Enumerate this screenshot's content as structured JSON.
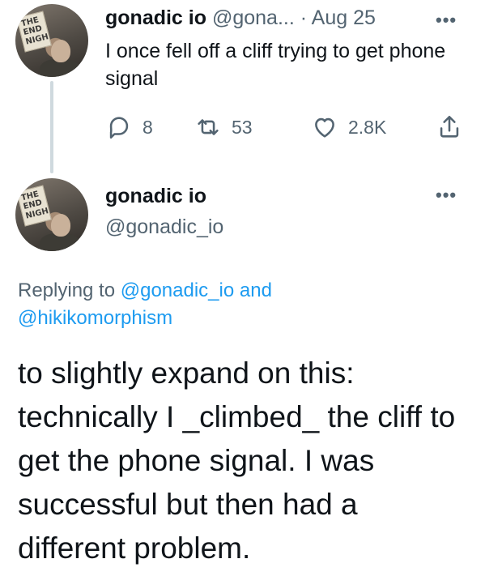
{
  "tweet1": {
    "author_name": "gonadic io",
    "author_handle": "@gona...",
    "separator": "·",
    "date": "Aug 25",
    "more": "•••",
    "text": "I once fell off a cliff trying to get phone signal",
    "actions": {
      "replies": "8",
      "retweets": "53",
      "likes": "2.8K"
    },
    "icons": [
      "reply-icon",
      "retweet-icon",
      "like-icon",
      "share-icon"
    ]
  },
  "tweet2": {
    "author_name": "gonadic io",
    "author_handle": "@gonadic_io",
    "more": "•••",
    "replying_prefix": "Replying to",
    "replying_mention1": "@gonadic_io",
    "replying_and": "and",
    "replying_mention2": "@hikikomorphism",
    "text": "to slightly expand on this: technically I _climbed_ the cliff to get the phone signal. I was successful but then had a different problem."
  },
  "colors": {
    "text_primary": "#0f1419",
    "text_secondary": "#536471",
    "accent": "#1d9bf0",
    "thread_line": "#cfd9de"
  }
}
